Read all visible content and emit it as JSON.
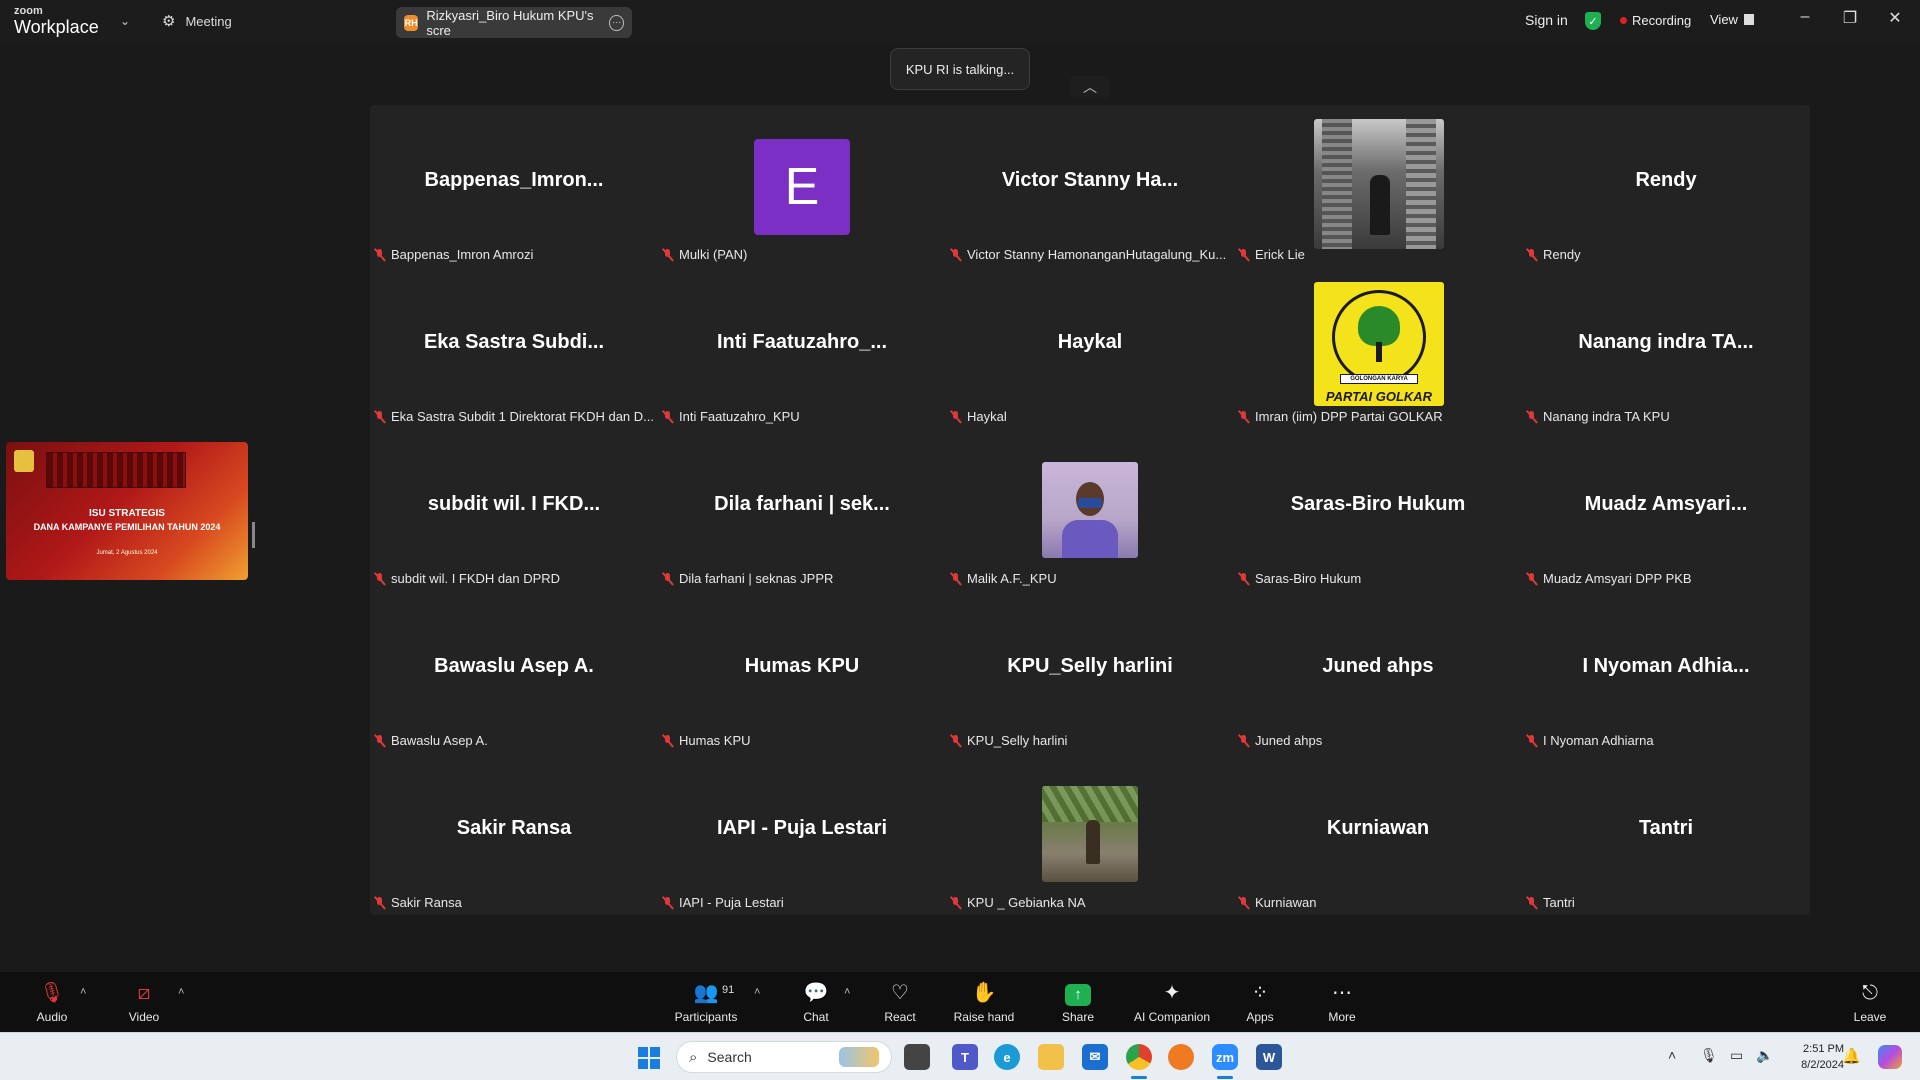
{
  "topbar": {
    "logo_top": "zoom",
    "logo_bottom": "Workplace",
    "meeting_label": "Meeting",
    "share_tab_label": "Rizkyasri_Biro Hukum KPU's scre",
    "share_tab_badge": "RH",
    "signin_label": "Sign in",
    "recording_label": "Recording",
    "view_label": "View"
  },
  "talking_label": "KPU RI is talking...",
  "shared_thumbnail": {
    "title_line1": "ISU STRATEGIS",
    "title_line2": "DANA KAMPANYE PEMILIHAN TAHUN 2024",
    "date_line": "Jumat, 2 Agustus 2024"
  },
  "participants_grid": [
    {
      "display": "Bappenas_Imron...",
      "name": "Bappenas_Imron Amrozi"
    },
    {
      "display": "E",
      "name": "Mulki (PAN)"
    },
    {
      "display": "Victor Stanny Ha...",
      "name": "Victor Stanny HamonanganHutagalung_Ku..."
    },
    {
      "display": "",
      "name": "Erick Lie"
    },
    {
      "display": "Rendy",
      "name": "Rendy"
    },
    {
      "display": "Eka Sastra Subdi...",
      "name": "Eka Sastra Subdit 1 Direktorat FKDH dan D..."
    },
    {
      "display": "Inti  Faatuzahro_...",
      "name": "Inti Faatuzahro_KPU"
    },
    {
      "display": "Haykal",
      "name": "Haykal"
    },
    {
      "display": "",
      "name": "Imran (iim) DPP Partai GOLKAR"
    },
    {
      "display": "Nanang indra TA...",
      "name": "Nanang indra TA KPU"
    },
    {
      "display": "subdit wil. I FKD...",
      "name": "subdit wil. I FKDH dan DPRD"
    },
    {
      "display": "Dila farhani | sek...",
      "name": "Dila farhani | seknas JPPR"
    },
    {
      "display": "",
      "name": "Malik A.F._KPU"
    },
    {
      "display": "Saras-Biro Hukum",
      "name": "Saras-Biro Hukum"
    },
    {
      "display": "Muadz Amsyari...",
      "name": "Muadz Amsyari DPP PKB"
    },
    {
      "display": "Bawaslu Asep A.",
      "name": "Bawaslu Asep A."
    },
    {
      "display": "Humas KPU",
      "name": "Humas KPU"
    },
    {
      "display": "KPU_Selly harlini",
      "name": "KPU_Selly harlini"
    },
    {
      "display": "Juned ahps",
      "name": "Juned ahps"
    },
    {
      "display": "I Nyoman Adhia...",
      "name": "I Nyoman Adhiarna"
    },
    {
      "display": "Sakir Ransa",
      "name": "Sakir Ransa"
    },
    {
      "display": "IAPI - Puja Lestari",
      "name": "IAPI - Puja Lestari"
    },
    {
      "display": "",
      "name": "KPU _ Gebianka NA"
    },
    {
      "display": "Kurniawan",
      "name": "Kurniawan"
    },
    {
      "display": "Tantri",
      "name": "Tantri"
    }
  ],
  "golkar_logo_text": {
    "banner": "GOLONGAN KARYA",
    "bottom": "PARTAI GOLKAR"
  },
  "toolbar": {
    "audio": "Audio",
    "video": "Video",
    "participants": "Participants",
    "participants_count": "91",
    "chat": "Chat",
    "react": "React",
    "raise_hand": "Raise hand",
    "share": "Share",
    "ai_companion": "AI Companion",
    "apps": "Apps",
    "more": "More",
    "leave": "Leave"
  },
  "taskbar": {
    "search_placeholder": "Search",
    "time": "2:51 PM",
    "date": "8/2/2024"
  },
  "colors": {
    "accent_green": "#1fb151",
    "mute_red": "#e03838",
    "avatar_purple": "#7c2fc4",
    "recording_red": "#e02020"
  }
}
